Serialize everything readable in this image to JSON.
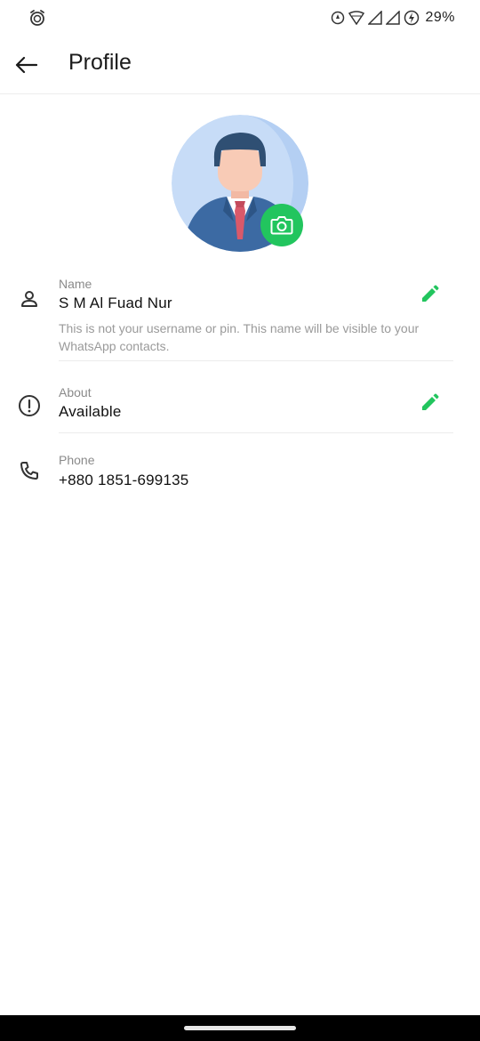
{
  "status_bar": {
    "battery_percent": "29%",
    "icons": [
      "alarm-icon",
      "data-saver-icon",
      "wifi-icon",
      "signal-icon",
      "signal-icon",
      "battery-charging-icon"
    ]
  },
  "header": {
    "title": "Profile",
    "back_icon": "arrow-back-icon"
  },
  "avatar": {
    "camera_icon": "camera-icon",
    "accent_color": "#22c55e"
  },
  "name_section": {
    "label": "Name",
    "value": "S M Al Fuad Nur",
    "hint": "This is not your username or pin. This name will be visible to your WhatsApp contacts.",
    "icon": "person-icon",
    "edit_icon": "pencil-icon"
  },
  "about_section": {
    "label": "About",
    "value": "Available",
    "icon": "info-icon",
    "edit_icon": "pencil-icon"
  },
  "phone_section": {
    "label": "Phone",
    "value": "+880 1851-699135",
    "icon": "phone-icon"
  }
}
